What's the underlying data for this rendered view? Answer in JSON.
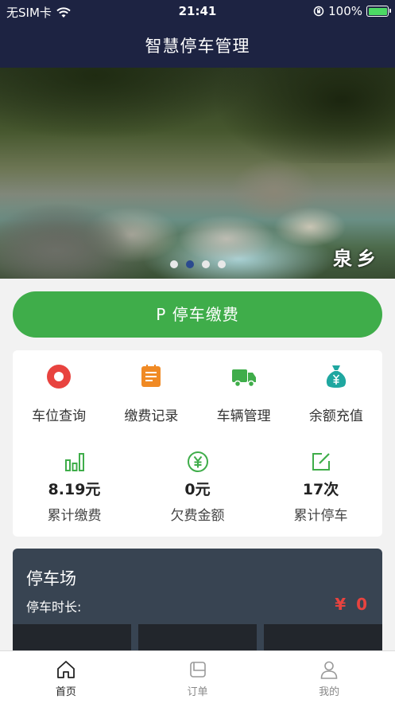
{
  "status_bar": {
    "carrier": "无SIM卡",
    "time": "21:41",
    "battery_percent": "100%",
    "wifi_icon": "wifi-icon",
    "lock_icon": "rotation-lock-icon",
    "battery_icon": "battery-charging-icon"
  },
  "header": {
    "title": "智慧停车管理"
  },
  "banner": {
    "stamp_text": "泉乡",
    "slide_count": 4,
    "active_slide": 1
  },
  "pay_button": {
    "label": "P 停车缴费"
  },
  "menu": {
    "items": [
      {
        "label": "车位查询",
        "icon": "record-circle-icon",
        "color": "#e8433f"
      },
      {
        "label": "缴费记录",
        "icon": "calendar-list-icon",
        "color": "#f08a24"
      },
      {
        "label": "车辆管理",
        "icon": "truck-icon",
        "color": "#3fad4a"
      },
      {
        "label": "余额充值",
        "icon": "money-bag-icon",
        "color": "#1fa7a0"
      }
    ]
  },
  "stats": {
    "items": [
      {
        "value": "8.19元",
        "label": "累计缴费",
        "icon": "bar-chart-icon"
      },
      {
        "value": "0元",
        "label": "欠费金额",
        "icon": "yen-circle-icon"
      },
      {
        "value": "17次",
        "label": "累计停车",
        "icon": "edit-square-icon"
      }
    ],
    "icon_color": "#3fad4a"
  },
  "parking_lot": {
    "title": "停车场",
    "duration_label": "停车时长:",
    "amount": "¥ 0"
  },
  "tabbar": {
    "items": [
      {
        "label": "首页",
        "icon": "home-icon",
        "active": true
      },
      {
        "label": "订单",
        "icon": "order-icon",
        "active": false
      },
      {
        "label": "我的",
        "icon": "user-icon",
        "active": false
      }
    ]
  },
  "colors": {
    "nav_bg": "#1d2342",
    "accent_green": "#3fad4a",
    "lot_card_bg": "#384452",
    "amount_red": "#e8433f"
  }
}
